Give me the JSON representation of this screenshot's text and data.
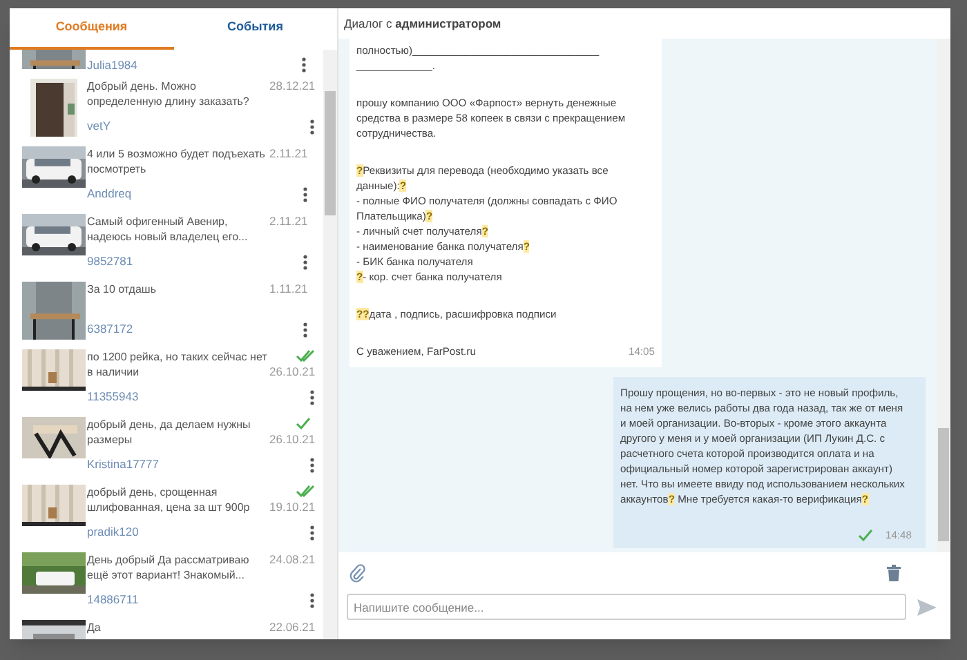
{
  "tabs": [
    {
      "label": "Сообщения",
      "selected": true
    },
    {
      "label": "События",
      "selected": false
    }
  ],
  "conversations": [
    {
      "user": "Julia1984"
    },
    {
      "text": "Добрый день. Можно определенную длину заказать?",
      "date": "28.12.21",
      "user": "vetY"
    },
    {
      "text": "4 или 5 возможно будет подъехать посмотреть",
      "date": "2.11.21",
      "user": "Anddreq"
    },
    {
      "text": "Самый офигенный Авенир, надеюсь новый владелец его...",
      "date": "2.11.21",
      "user": "9852781"
    },
    {
      "text": "За 10 отдашь",
      "date": "1.11.21",
      "user": "6387172"
    },
    {
      "text": "по 1200 рейка, но таких сейчас нет в наличии",
      "date": "26.10.21",
      "user": "11355943",
      "read": true
    },
    {
      "text": "добрый день, да делаем нужны размеры",
      "date": "26.10.21",
      "user": "Kristina17777",
      "read": false
    },
    {
      "text": "добрый день, срощенная шлифованная, цена за шт 900р",
      "date": "19.10.21",
      "user": "pradik120",
      "read": true
    },
    {
      "text": "День добрый Да рассматриваю ещё этот вариант! Знакомый...",
      "date": "24.08.21",
      "user": "14886711"
    },
    {
      "text": "Да",
      "date": "22.06.21"
    }
  ],
  "dialog": {
    "title": "Диалог с **администратором**",
    "messages": [
      {
        "kind": "incoming",
        "time": "14:05",
        "paragraphs": [
          [
            [
              {
                "t": "полностью)________________________________"
              }
            ],
            [
              {
                "t": "_____________."
              }
            ]
          ],
          [
            [
              {
                "t": "прошу компанию ООО «Фарпост» вернуть денежные"
              }
            ],
            [
              {
                "t": "средства в размере 58 копеек в связи с прекращением"
              }
            ],
            [
              {
                "t": "сотрудничества."
              }
            ]
          ],
          [
            [
              {
                "t": "?",
                "highlighted": true
              },
              {
                "t": "Реквизиты для перевода (необходимо указать все"
              }
            ],
            [
              {
                "t": "данные):"
              },
              {
                "t": "?",
                "highlighted": true
              }
            ],
            [
              {
                "t": "- полные ФИО получателя (должны совпадать с ФИО"
              }
            ],
            [
              {
                "t": "Плательщика)"
              },
              {
                "t": "?",
                "highlighted": true
              }
            ],
            [
              {
                "t": "- личный счет получателя"
              },
              {
                "t": "?",
                "highlighted": true
              }
            ],
            [
              {
                "t": "- наименование банка получателя"
              },
              {
                "t": "?",
                "highlighted": true
              }
            ],
            [
              {
                "t": "- БИК банка получателя"
              }
            ],
            [
              {
                "t": "?",
                "highlighted": true
              },
              {
                "t": "- кор. счет банка получателя"
              }
            ]
          ],
          [
            [
              {
                "t": "??",
                "highlighted": true
              },
              {
                "t": "дата , подпись, расшифровка подписи"
              }
            ]
          ],
          [
            [
              {
                "t": "С уважением, FarPost.ru"
              }
            ]
          ]
        ]
      },
      {
        "kind": "outgoing",
        "time": "14:48",
        "read": false,
        "paragraphs": [
          [
            [
              {
                "t": "Прошу прощения, но во-первых - это не новый профиль,"
              }
            ],
            [
              {
                "t": "на нем уже велись работы два года назад, так же от меня"
              }
            ],
            [
              {
                "t": "и моей организации. Во-вторых - кроме этого аккаунта"
              }
            ],
            [
              {
                "t": "другого у меня и у моей организации (ИП Лукин Д.С. с"
              }
            ],
            [
              {
                "t": "расчетного счета которой производится оплата и на"
              }
            ],
            [
              {
                "t": "официальный номер которой зарегистрирован аккаунт)"
              }
            ],
            [
              {
                "t": "нет. Что вы имеете ввиду под использованием нескольких"
              }
            ],
            [
              {
                "t": "аккаунтов"
              },
              {
                "t": "?",
                "highlighted": true
              },
              {
                "t": " Мне требуется какая-то верификация"
              },
              {
                "t": "?",
                "highlighted": true
              }
            ]
          ]
        ]
      }
    ],
    "composer": {
      "placeholder": "Напишите сообщение..."
    }
  }
}
